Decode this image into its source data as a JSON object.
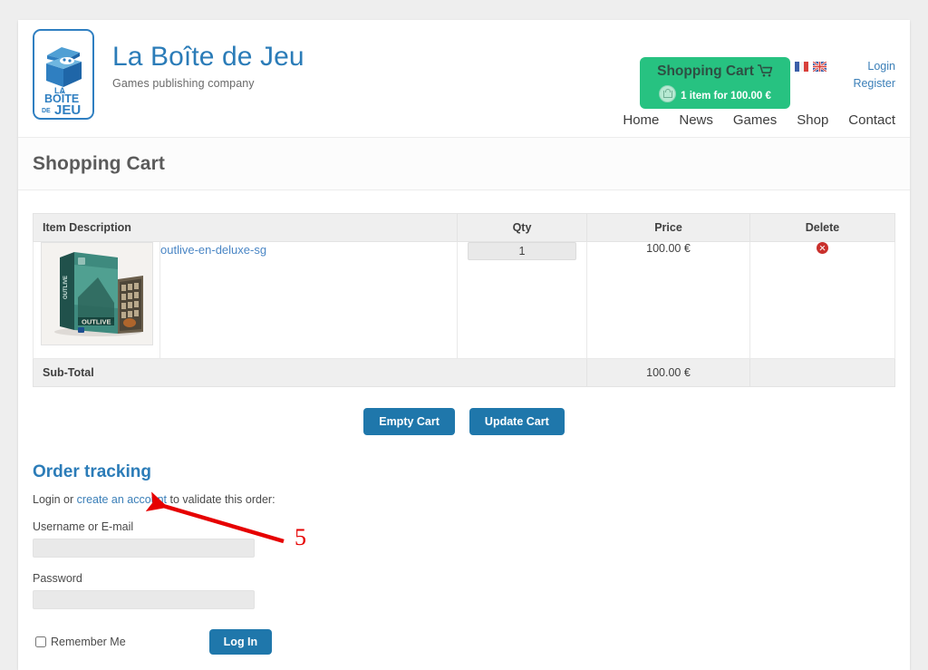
{
  "brand": {
    "logo_name": "la-boite-de-jeu-logo",
    "logo_text_top": "LA",
    "logo_text_mid": "BOÎTE",
    "logo_text_de": "DE",
    "logo_text_bottom": "JEU",
    "title": "La Boîte de Jeu",
    "subtitle": "Games publishing company"
  },
  "header": {
    "cart": {
      "label": "Shopping Cart",
      "summary": "1 item for 100.00 €",
      "bg_color": "#27c281"
    },
    "flags": [
      {
        "name": "flag-fr",
        "title": "Français"
      },
      {
        "name": "flag-en",
        "title": "English"
      }
    ],
    "auth": {
      "login": "Login",
      "register": "Register"
    },
    "nav": [
      {
        "label": "Home"
      },
      {
        "label": "News"
      },
      {
        "label": "Games"
      },
      {
        "label": "Shop"
      },
      {
        "label": "Contact"
      }
    ]
  },
  "page": {
    "title": "Shopping Cart"
  },
  "cart_table": {
    "columns": [
      "Item Description",
      "Qty",
      "Price",
      "Delete"
    ],
    "rows": [
      {
        "thumb_name": "product-thumbnail-outlive",
        "name": "outlive-en-deluxe-sg",
        "qty": "1",
        "price": "100.00 €"
      }
    ],
    "subtotal_label": "Sub-Total",
    "subtotal_value": "100.00 €"
  },
  "cart_actions": {
    "empty": "Empty Cart",
    "update": "Update Cart",
    "button_color": "#1f77ab"
  },
  "order_tracking": {
    "heading": "Order tracking",
    "note_prefix": "Login or ",
    "note_link": "create an account",
    "note_suffix": " to validate this order:",
    "username_label": "Username or E-mail",
    "username_value": "",
    "password_label": "Password",
    "password_value": "",
    "remember_label": "Remember Me",
    "login_button": "Log In"
  },
  "annotation": {
    "number": "5",
    "color": "#e60000"
  }
}
